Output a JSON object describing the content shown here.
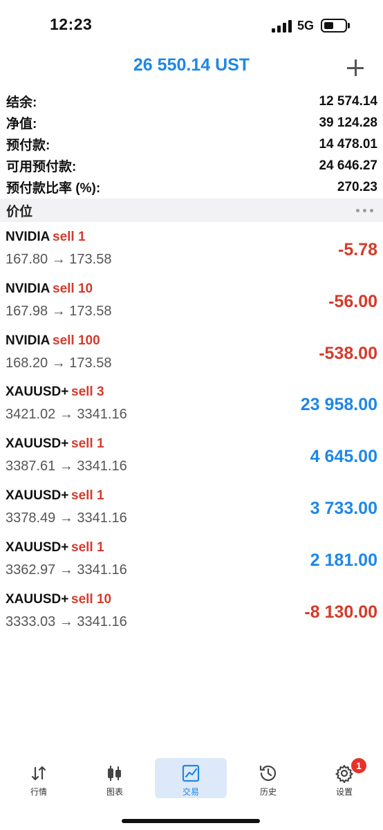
{
  "status_bar": {
    "time": "12:23",
    "network": "5G"
  },
  "header": {
    "title": "26 550.14 UST",
    "add_icon": "plus-icon"
  },
  "summary": [
    {
      "label": "结余:",
      "value": "12 574.14"
    },
    {
      "label": "净值:",
      "value": "39 124.28"
    },
    {
      "label": "预付款:",
      "value": "14 478.01"
    },
    {
      "label": "可用预付款:",
      "value": "24 646.27"
    },
    {
      "label": "预付款比率 (%):",
      "value": "270.23"
    }
  ],
  "section": {
    "title": "价位",
    "more_icon": "more-dots-icon"
  },
  "positions": [
    {
      "symbol": "NVIDIA",
      "side": "sell 1",
      "prices": "167.80 → 173.58",
      "profit": "-5.78",
      "negative": true
    },
    {
      "symbol": "NVIDIA",
      "side": "sell 10",
      "prices": "167.98 → 173.58",
      "profit": "-56.00",
      "negative": true
    },
    {
      "symbol": "NVIDIA",
      "side": "sell 100",
      "prices": "168.20 → 173.58",
      "profit": "-538.00",
      "negative": true
    },
    {
      "symbol": "XAUUSD+",
      "side": "sell 3",
      "prices": "3421.02 → 3341.16",
      "profit": "23 958.00",
      "negative": false
    },
    {
      "symbol": "XAUUSD+",
      "side": "sell 1",
      "prices": "3387.61 → 3341.16",
      "profit": "4 645.00",
      "negative": false
    },
    {
      "symbol": "XAUUSD+",
      "side": "sell 1",
      "prices": "3378.49 → 3341.16",
      "profit": "3 733.00",
      "negative": false
    },
    {
      "symbol": "XAUUSD+",
      "side": "sell 1",
      "prices": "3362.97 → 3341.16",
      "profit": "2 181.00",
      "negative": false
    },
    {
      "symbol": "XAUUSD+",
      "side": "sell 10",
      "prices": "3333.03 → 3341.16",
      "profit": "-8 130.00",
      "negative": true
    }
  ],
  "colors": {
    "accent": "#1e87e6",
    "loss": "#d53a2c",
    "profit": "#1e87e6"
  },
  "tabs": [
    {
      "label": "行情",
      "icon": "quotes-arrows-icon",
      "active": false
    },
    {
      "label": "图表",
      "icon": "candlestick-chart-icon",
      "active": false
    },
    {
      "label": "交易",
      "icon": "trade-chart-icon",
      "active": true
    },
    {
      "label": "历史",
      "icon": "history-clock-icon",
      "active": false
    },
    {
      "label": "设置",
      "icon": "settings-gear-icon",
      "active": false
    }
  ],
  "settings_badge": "1"
}
